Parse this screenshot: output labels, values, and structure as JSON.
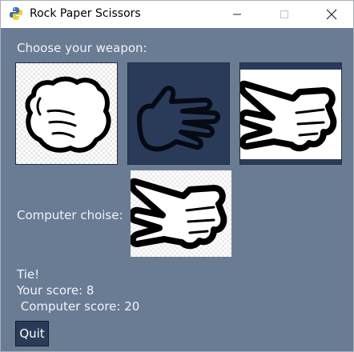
{
  "window": {
    "title": "Rock Paper Scissors",
    "minimize_icon": "minimize-icon",
    "maximize_icon": "maximize-icon",
    "close_icon": "close-icon"
  },
  "game": {
    "prompt": "Choose your weapon:",
    "weapons": [
      {
        "name": "rock",
        "icon": "rock-hand-icon"
      },
      {
        "name": "paper",
        "icon": "paper-hand-icon",
        "selected": true
      },
      {
        "name": "scissors",
        "icon": "scissors-hand-icon"
      }
    ],
    "computer_label": "Computer choise:",
    "computer_choice_icon": "scissors-hand-icon",
    "result": "Tie!",
    "your_score": "Your score: 8",
    "computer_score": " Computer score: 20",
    "quit_label": "Quit"
  },
  "colors": {
    "background": "#6a7b94",
    "button_dark": "#2a3b59",
    "titlebar": "#ffffff"
  }
}
